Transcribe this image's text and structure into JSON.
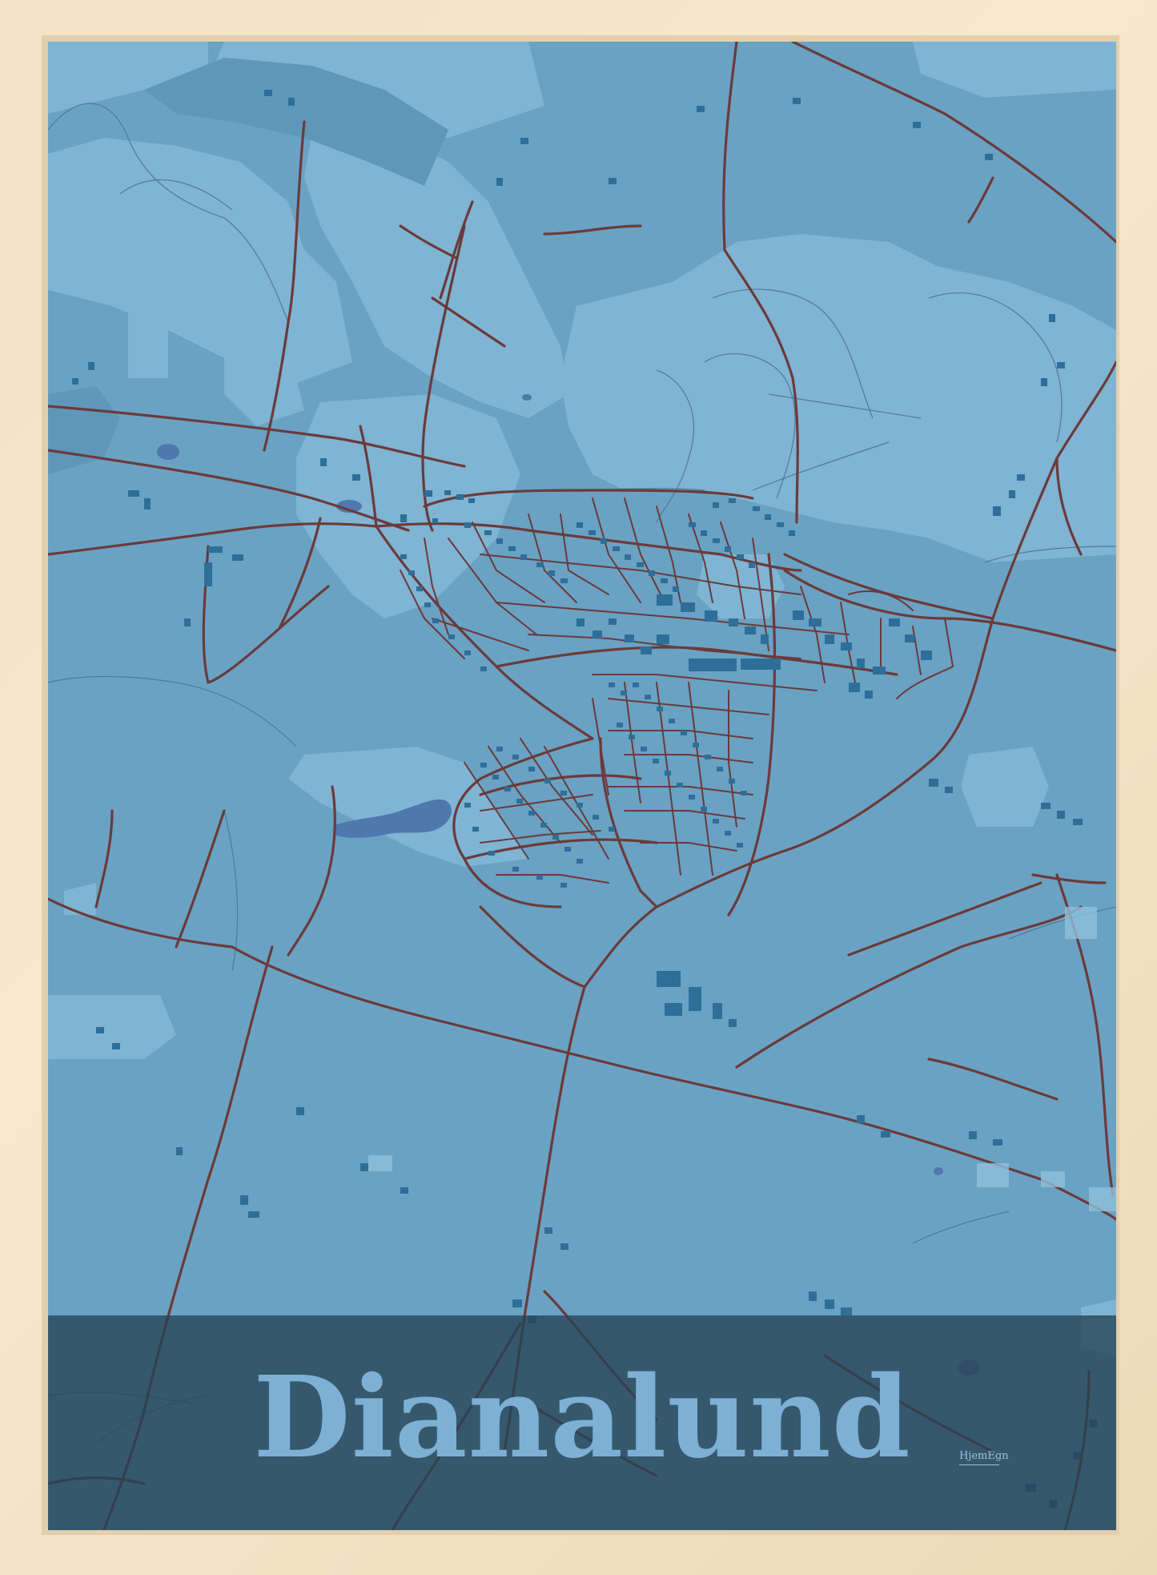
{
  "poster": {
    "city_name": "Dianalund",
    "brand": "HjemEgn"
  },
  "map": {
    "colors": {
      "land": "#6aa2c3",
      "light_fields": "#7fb4d3",
      "water": "#4f78ae",
      "buildings": "#2d6f99",
      "roads": "#6b3a3a",
      "paths": "#4f7b96",
      "title_band": "#264254",
      "title_text": "#7db0d4",
      "frame": "#f3e2c3"
    }
  }
}
